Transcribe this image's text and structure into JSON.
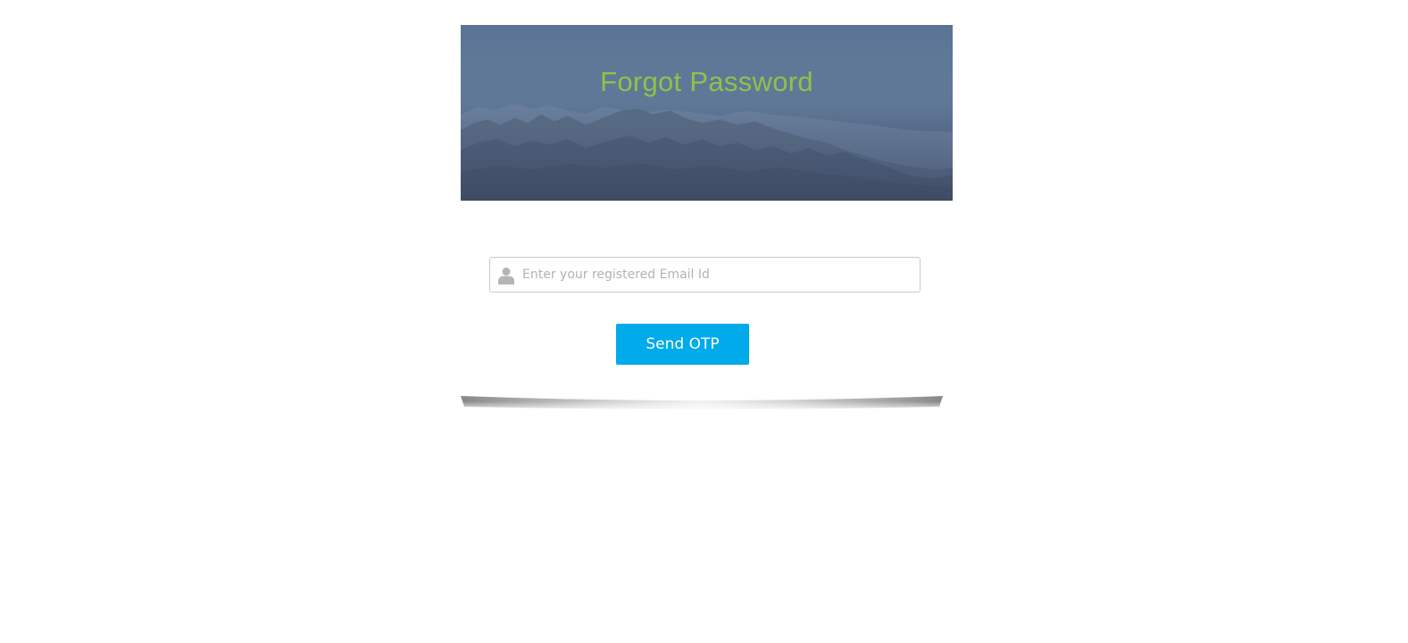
{
  "page": {
    "title": "Forgot Password"
  },
  "form": {
    "email_placeholder": "Enter your registered Email Id",
    "email_value": "",
    "send_label": "Send OTP"
  },
  "icons": {
    "field_icon": "user-icon"
  },
  "colors": {
    "title": "#8cc34a",
    "button": "#00aaeb",
    "button_text": "#ffffff"
  }
}
